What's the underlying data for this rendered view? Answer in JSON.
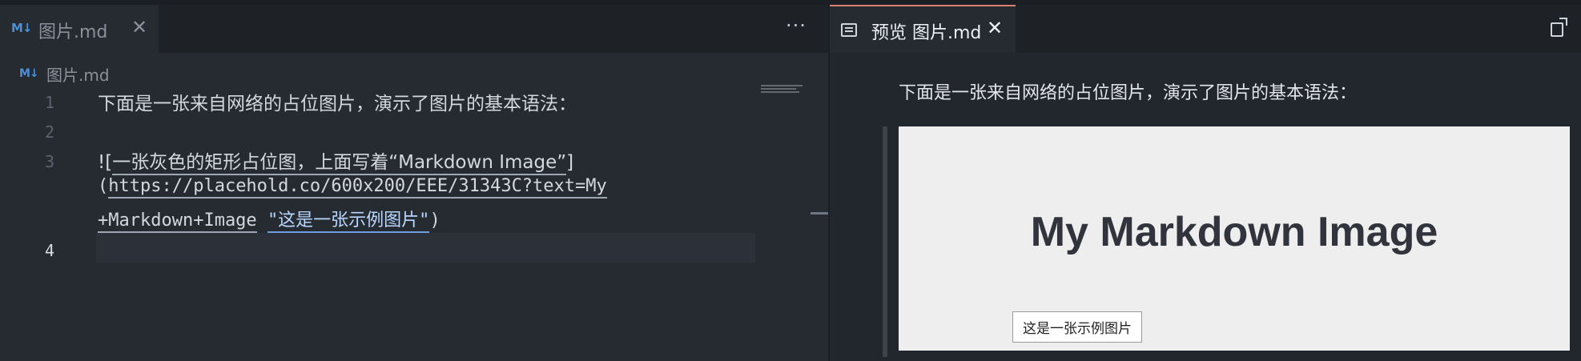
{
  "editor": {
    "tab": {
      "label": "图片.md",
      "icon": "markdown-icon",
      "close_glyph": "✕"
    },
    "more_actions_glyph": "···",
    "breadcrumb": {
      "label": "图片.md",
      "icon": "markdown-icon"
    },
    "line_numbers": [
      "1",
      "2",
      "3",
      "4"
    ],
    "active_line": "4",
    "lines": {
      "l1": "下面是一张来自网络的占位图片，演示了图片的基本语法：",
      "l3_prefix": "![",
      "l3_alt": "一张灰色的矩形占位图，上面写着“Markdown Image”",
      "l3_suffix": "]",
      "l3b_open": "(",
      "l3b_url": "https://placehold.co/600x200/EEE/31343C?text=My",
      "l3c_url": "+Markdown+Image",
      "l3c_title": "\"这是一张示例图片\"",
      "l3c_close": ")"
    }
  },
  "preview": {
    "tab": {
      "label": "预览 图片.md",
      "icon": "preview-icon",
      "close_glyph": "✕"
    },
    "open_source_icon": "open-source-icon",
    "paragraph": "下面是一张来自网络的占位图片，演示了图片的基本语法：",
    "image": {
      "text": "My Markdown Image",
      "background": "#EEEEEE",
      "text_color": "#31343C"
    },
    "tooltip": "这是一张示例图片"
  },
  "colors": {
    "accent_tab_border": "#d8826f",
    "link": "#6b9fe0",
    "markdown_icon": "#4d8fd6"
  }
}
